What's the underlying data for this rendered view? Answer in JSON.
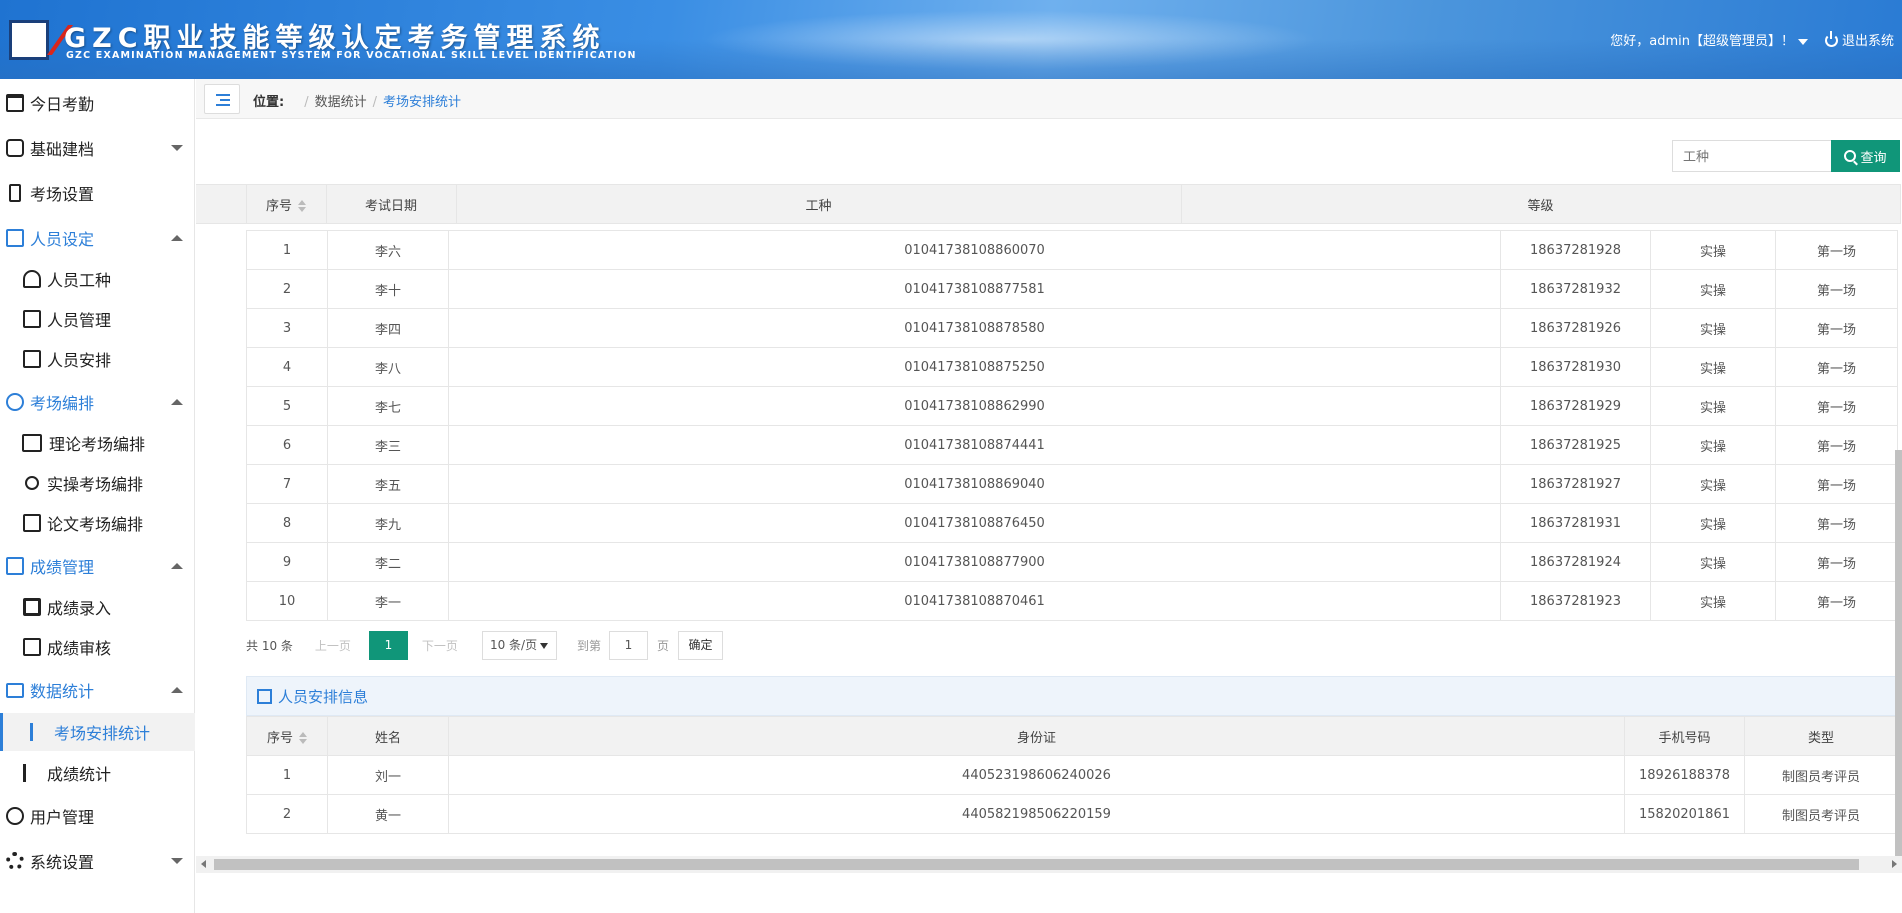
{
  "header": {
    "title_cn": "GZC职业技能等级认定考务管理系统",
    "title_en": "GZC EXAMINATION MANAGEMENT SYSTEM FOR VOCATIONAL SKILL LEVEL IDENTIFICATION",
    "greeting": "您好，admin【超级管理员】！",
    "logout": "退出系统"
  },
  "sidebar": {
    "items": [
      {
        "label": "今日考勤",
        "icon": "calendar-icon"
      },
      {
        "label": "基础建档",
        "icon": "file-add-icon"
      },
      {
        "label": "考场设置",
        "icon": "building-settings-icon"
      },
      {
        "label": "人员设定",
        "icon": "person-doc-icon"
      },
      {
        "label": "人员工种",
        "icon": "worker-icon"
      },
      {
        "label": "人员管理",
        "icon": "person-doc-icon"
      },
      {
        "label": "人员安排",
        "icon": "id-card-icon"
      },
      {
        "label": "考场编排",
        "icon": "user-icon"
      },
      {
        "label": "理论考场编排",
        "icon": "book-icon"
      },
      {
        "label": "实操考场编排",
        "icon": "wrench-icon"
      },
      {
        "label": "论文考场编排",
        "icon": "paper-icon"
      },
      {
        "label": "成绩管理",
        "icon": "score-icon"
      },
      {
        "label": "成绩录入",
        "icon": "score-edit-icon"
      },
      {
        "label": "成绩审核",
        "icon": "score-review-icon"
      },
      {
        "label": "数据统计",
        "icon": "chart-icon"
      },
      {
        "label": "考场安排统计",
        "icon": "bar-list-icon"
      },
      {
        "label": "成绩统计",
        "icon": "bar-list-icon"
      },
      {
        "label": "用户管理",
        "icon": "users-icon"
      },
      {
        "label": "系统设置",
        "icon": "gear-icon"
      }
    ]
  },
  "breadcrumb": {
    "prefix": "位置:",
    "level1": "数据统计",
    "current": "考场安排统计"
  },
  "search": {
    "placeholder": "工种",
    "button": "查询"
  },
  "main_table": {
    "headers": [
      "序号",
      "考试日期",
      "工种",
      "等级"
    ],
    "rows": [
      [
        "1",
        "李六",
        "01041738108860070",
        "18637281928",
        "实操",
        "第一场"
      ],
      [
        "2",
        "李十",
        "01041738108877581",
        "18637281932",
        "实操",
        "第一场"
      ],
      [
        "3",
        "李四",
        "01041738108878580",
        "18637281926",
        "实操",
        "第一场"
      ],
      [
        "4",
        "李八",
        "01041738108875250",
        "18637281930",
        "实操",
        "第一场"
      ],
      [
        "5",
        "李七",
        "01041738108862990",
        "18637281929",
        "实操",
        "第一场"
      ],
      [
        "6",
        "李三",
        "01041738108874441",
        "18637281925",
        "实操",
        "第一场"
      ],
      [
        "7",
        "李五",
        "01041738108869040",
        "18637281927",
        "实操",
        "第一场"
      ],
      [
        "8",
        "李九",
        "01041738108876450",
        "18637281931",
        "实操",
        "第一场"
      ],
      [
        "9",
        "李二",
        "01041738108877900",
        "18637281924",
        "实操",
        "第一场"
      ],
      [
        "10",
        "李一",
        "01041738108870461",
        "18637281923",
        "实操",
        "第一场"
      ]
    ]
  },
  "pager": {
    "total": "共 10 条",
    "prev": "上一页",
    "page": "1",
    "next": "下一页",
    "size": "10 条/页",
    "goto": "到第",
    "goto_value": "1",
    "page_unit": "页",
    "confirm": "确定"
  },
  "staff_section": {
    "title": "人员安排信息"
  },
  "staff_table": {
    "headers": [
      "序号",
      "姓名",
      "身份证",
      "手机号码",
      "类型"
    ],
    "rows": [
      [
        "1",
        "刘一",
        "440523198606240026",
        "18926188378",
        "制图员考评员"
      ],
      [
        "2",
        "黄一",
        "440582198506220159",
        "15820201861",
        "制图员考评员"
      ]
    ]
  },
  "colors": {
    "accent": "#2d7fd8",
    "button": "#109679",
    "header": "#2f84dc"
  }
}
